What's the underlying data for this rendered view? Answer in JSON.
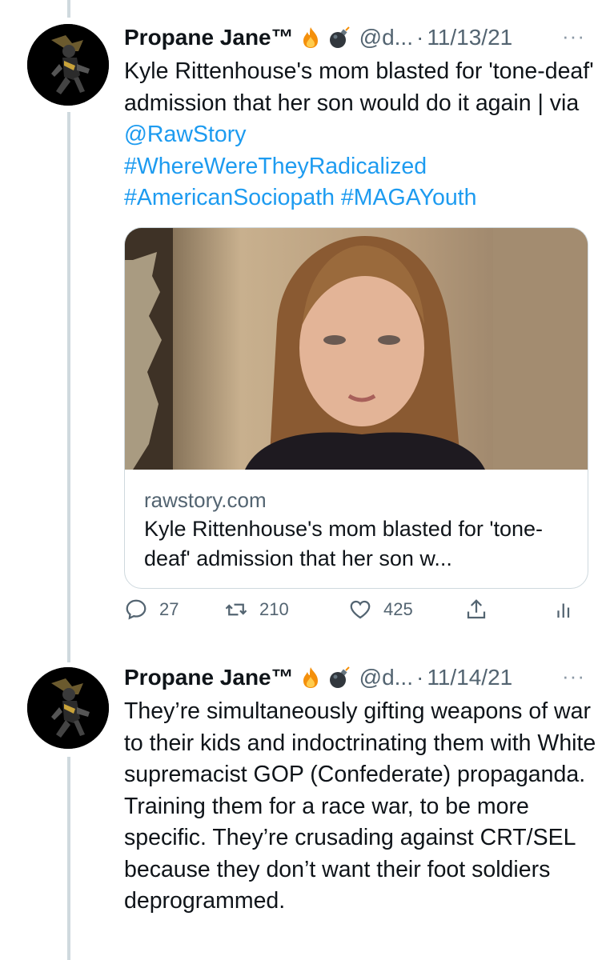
{
  "tweets": [
    {
      "display_name": "Propane Jane™",
      "handle": "@d...",
      "separator": "·",
      "date": "11/13/21",
      "more": "···",
      "text_part1": "Kyle Rittenhouse's mom blasted for 'tone-deaf' admission that her son would do it again | via ",
      "mention": "@RawStory",
      "hashtags": [
        "#WhereWereTheyRadicalized",
        "#AmericanSociopath",
        "#MAGAYouth"
      ],
      "card": {
        "domain": "rawstory.com",
        "title": "Kyle Rittenhouse's mom blasted for 'tone-deaf' admission that her son w..."
      },
      "stats": {
        "replies": "27",
        "retweets": "210",
        "likes": "425"
      }
    },
    {
      "display_name": "Propane Jane™",
      "handle": "@d...",
      "separator": "·",
      "date": "11/14/21",
      "more": "···",
      "text": "They’re simultaneously gifting weapons of war to their kids and indoctrinating them with White supremacist GOP (Confederate) propaganda. Training them for a race war, to be more specific. They’re crusading against CRT/SEL because they don’t want their foot soldiers deprogrammed."
    }
  ],
  "icons": {
    "avatar": "avatar-image",
    "fire": "fire-emoji",
    "bomb": "bomb-emoji",
    "reply": "reply-icon",
    "retweet": "retweet-icon",
    "like": "heart-icon",
    "share": "share-icon",
    "analytics": "analytics-icon"
  },
  "colors": {
    "link": "#1d9bf0",
    "secondary_text": "#536471",
    "thread_line": "#cfd9de"
  }
}
